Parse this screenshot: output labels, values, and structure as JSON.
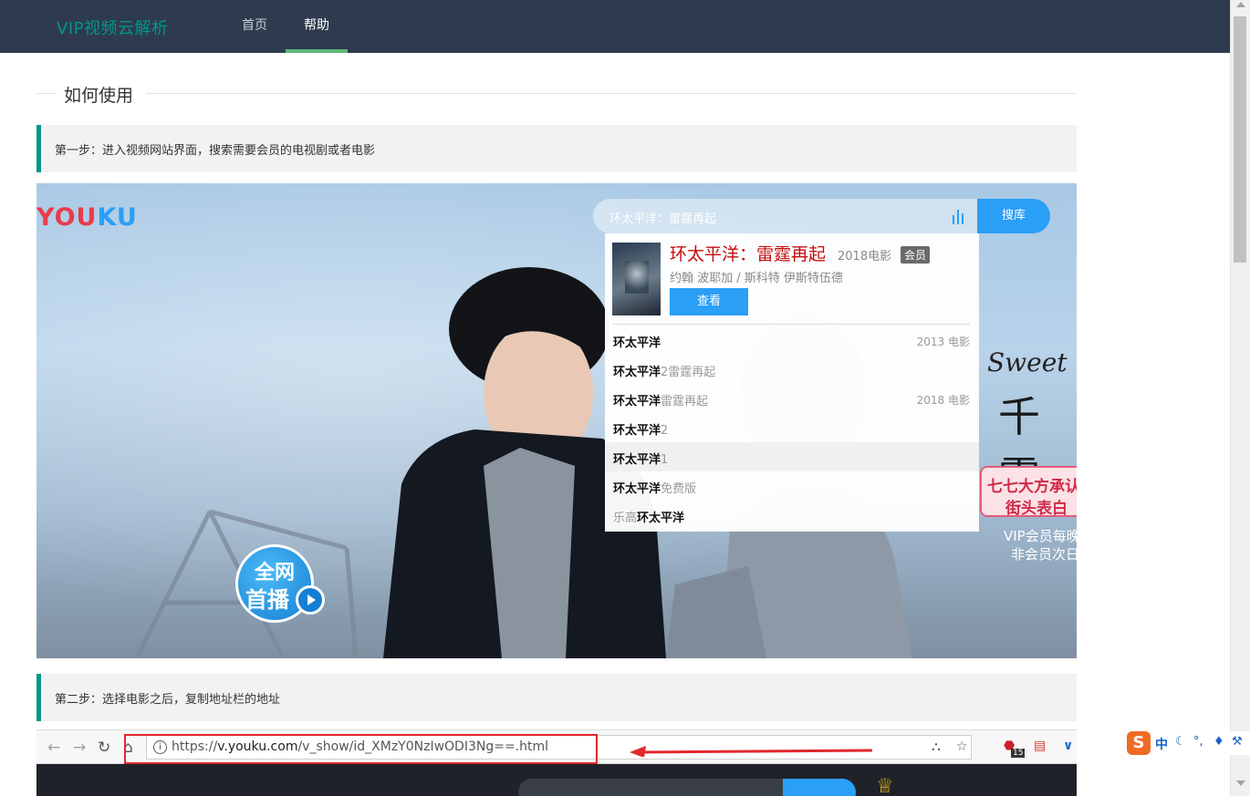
{
  "header": {
    "logo": "VIP视频云解析",
    "nav": [
      {
        "label": "首页"
      },
      {
        "label": "帮助"
      }
    ]
  },
  "section": {
    "title": "如何使用"
  },
  "steps": [
    {
      "text": "第一步：进入视频网站界面，搜索需要会员的电视剧或者电影"
    },
    {
      "text": "第二步：选择电影之后，复制地址栏的地址"
    }
  ],
  "youku_screenshot": {
    "logo_part1": "YOU",
    "logo_part2": "KU",
    "search_text": "环太平洋：雷霆再起",
    "search_button": "搜库",
    "result": {
      "title": "环太平洋：雷霆再起",
      "year_type": "2018电影",
      "badge": "会员",
      "cast": "约翰 波耶加 / 斯科特 伊斯特伍德",
      "watch_button": "查看"
    },
    "suggestions": [
      {
        "bold": "环太平洋",
        "rest": "",
        "prefix": "",
        "meta": "2013 电影"
      },
      {
        "bold": "环太平洋",
        "rest": "2雷霆再起",
        "prefix": "",
        "meta": ""
      },
      {
        "bold": "环太平洋",
        "rest": "雷霆再起",
        "prefix": "",
        "meta": "2018 电影"
      },
      {
        "bold": "环太平洋",
        "rest": "2",
        "prefix": "",
        "meta": ""
      },
      {
        "bold": "环太平洋",
        "rest": "1",
        "prefix": "",
        "meta": ""
      },
      {
        "bold": "环太平洋",
        "rest": "免费版",
        "prefix": "",
        "meta": ""
      },
      {
        "bold": "环太平洋",
        "rest": "",
        "prefix": "乐高",
        "meta": ""
      }
    ],
    "poster_sweet": "Sweet",
    "poster_title": "千零",
    "poster_line1": "七七大方承认",
    "poster_line2": "街头表白",
    "poster_vip1": "VIP会员每晚",
    "poster_vip2": "非会员次日",
    "premiere_line1": "全网",
    "premiere_line2": "首播"
  },
  "browser_screenshot": {
    "url_scheme": "https://",
    "url_host": "v.youku.com",
    "url_path": "/v_show/id_XMzY0NzIwODI3Ng==.html",
    "ext_badge": "15"
  },
  "ime": {
    "logo": "S",
    "mode": "中"
  },
  "colors": {
    "accent": "#009688",
    "topbar": "#2e3b4e",
    "youku_blue": "#2a9ff6",
    "youku_red": "#e93c4c",
    "highlight_red": "#e0282e"
  }
}
